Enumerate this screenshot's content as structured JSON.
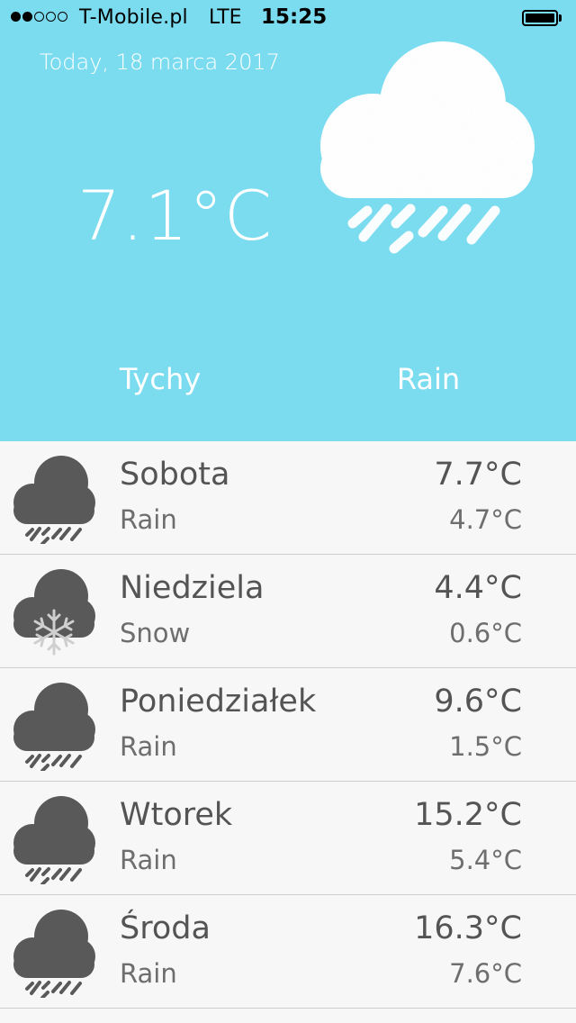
{
  "status_bar": {
    "signal_bars": 2,
    "signal_total": 5,
    "carrier": "T-Mobile.pl",
    "network": "LTE",
    "time": "15:25",
    "battery_level": 1.0
  },
  "current": {
    "date": "Today, 18 marca 2017",
    "temperature": "7.1°C",
    "icon": "rain-cloud-icon",
    "city": "Tychy",
    "condition": "Rain"
  },
  "colors": {
    "hero_background": "#7bdcf0",
    "list_background": "#f7f7f7",
    "icon_gray": "#595959",
    "hero_text": "#ffffff"
  },
  "forecast": [
    {
      "day": "Sobota",
      "condition": "Rain",
      "high": "7.7°C",
      "low": "4.7°C",
      "icon": "rain-cloud-icon"
    },
    {
      "day": "Niedziela",
      "condition": "Snow",
      "high": "4.4°C",
      "low": "0.6°C",
      "icon": "snow-cloud-icon"
    },
    {
      "day": "Poniedziałek",
      "condition": "Rain",
      "high": "9.6°C",
      "low": "1.5°C",
      "icon": "rain-cloud-icon"
    },
    {
      "day": "Wtorek",
      "condition": "Rain",
      "high": "15.2°C",
      "low": "5.4°C",
      "icon": "rain-cloud-icon"
    },
    {
      "day": "Środa",
      "condition": "Rain",
      "high": "16.3°C",
      "low": "7.6°C",
      "icon": "rain-cloud-icon"
    }
  ]
}
